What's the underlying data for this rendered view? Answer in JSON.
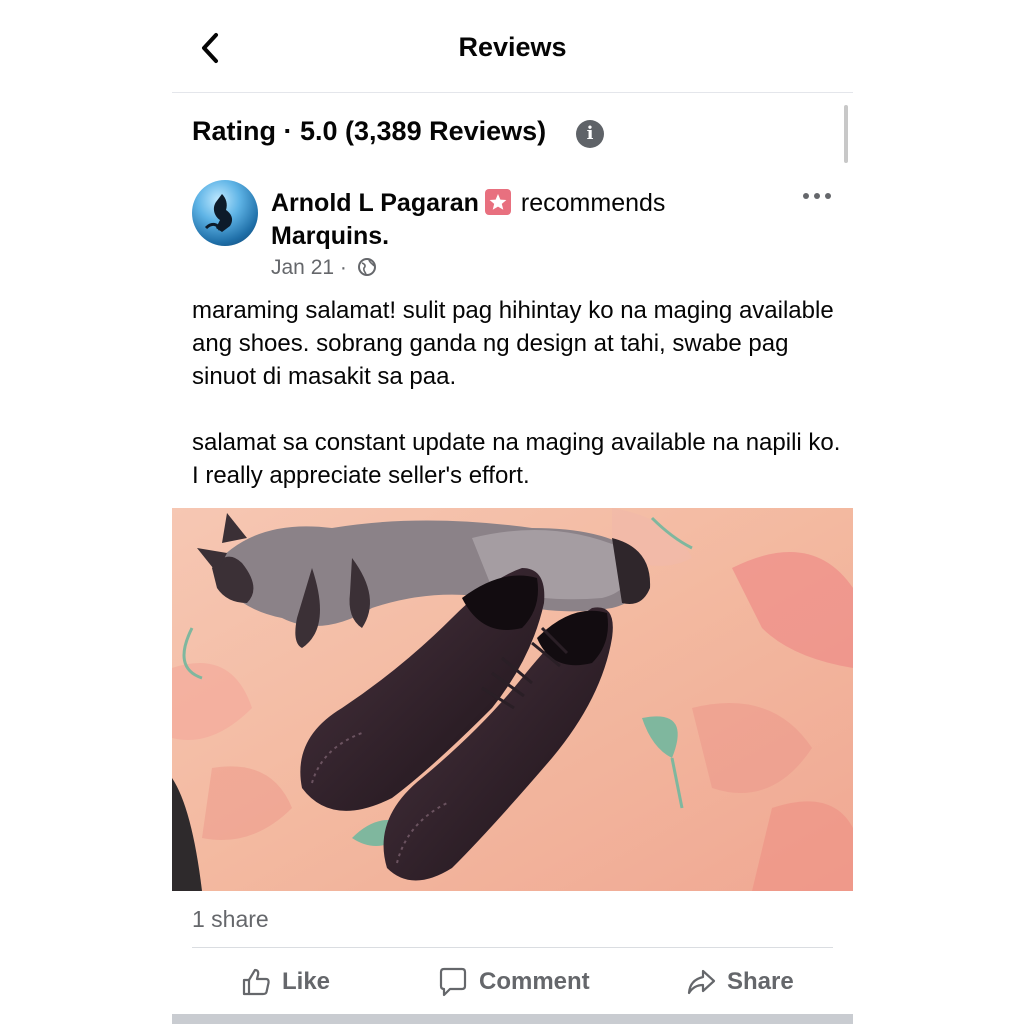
{
  "header": {
    "title": "Reviews"
  },
  "rating": {
    "title": "Rating · 5.0 (3,389 Reviews)"
  },
  "post": {
    "author": "Arnold L Pagaran",
    "verb": "recommends",
    "page": "Marquins.",
    "date": "Jan 21 ·",
    "paragraphs": [
      "maraming salamat! sulit pag hihintay ko na maging available ang shoes. sobrang ganda ng design at tahi, swabe pag sinuot di masakit sa paa.",
      "salamat sa constant update na maging available na napili ko. I really appreciate seller's effort."
    ],
    "shares": "1 share"
  },
  "actions": {
    "like": "Like",
    "comment": "Comment",
    "share": "Share"
  },
  "icons": {
    "back": "chevron-left-icon",
    "info": "info-icon",
    "badge": "recommendation-star-icon",
    "privacy": "globe-icon",
    "more": "more-horizontal-icon",
    "like": "thumbs-up-icon",
    "comment": "comment-bubble-icon",
    "share": "share-arrow-icon"
  },
  "colors": {
    "text": "#050505",
    "secondary": "#65676b",
    "badge": "#e8707f",
    "divider": "#dadde1"
  }
}
